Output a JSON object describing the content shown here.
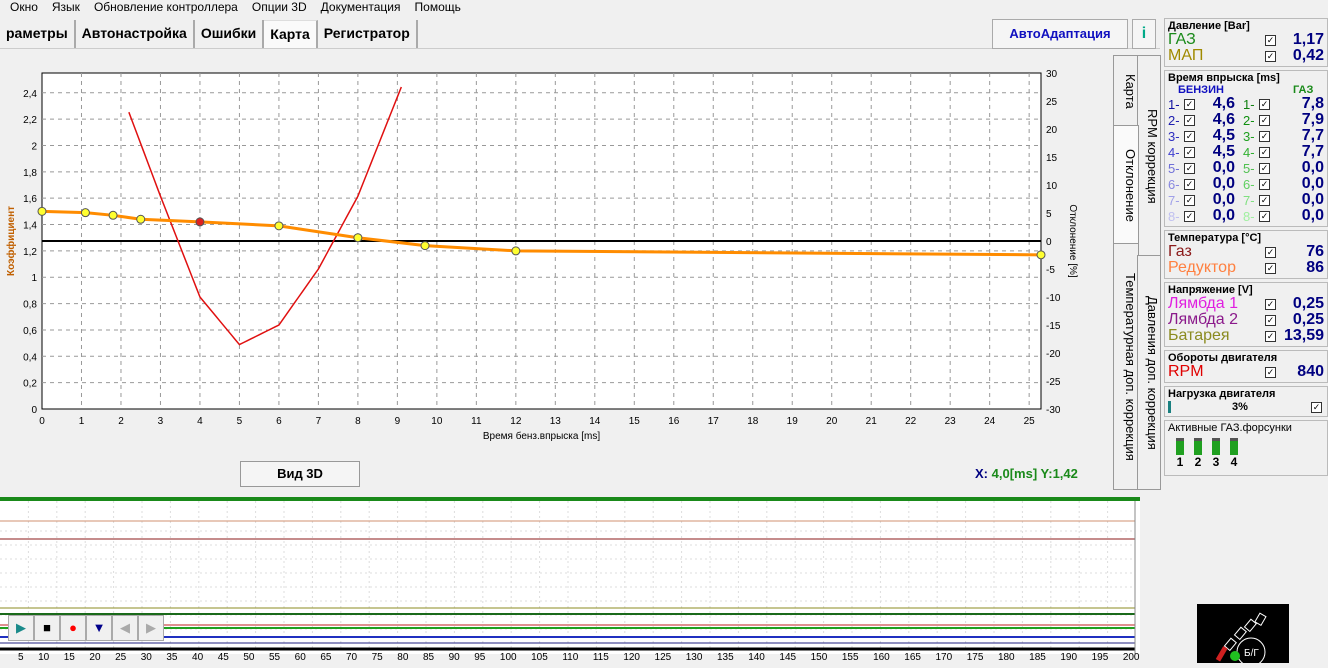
{
  "menu": [
    "Окно",
    "Язык",
    "Обновление контроллера",
    "Опции 3D",
    "Документация",
    "Помощь"
  ],
  "tabs": [
    "раметры",
    "Автонастройка",
    "Ошибки",
    "Карта",
    "Регистратор"
  ],
  "active_tab": 3,
  "auto_button": "АвтоАдаптация",
  "side_tabs": [
    "Карта",
    "RPM коррекция",
    "Отклонение",
    "Температурная доп. коррекция",
    "Давления доп. коррекция"
  ],
  "view3d": "Вид 3D",
  "coords": {
    "x_label": "X:",
    "x": "4,0[ms]",
    "y": "Y:1,42"
  },
  "chart_data": {
    "type": "line",
    "xlabel": "Время бенз.впрыска [ms]",
    "ylabel": "Коэффициент",
    "y2label": "Отклонение [%]",
    "xlim": [
      0,
      25.3
    ],
    "ylim": [
      0,
      2.55
    ],
    "y2lim": [
      -30,
      30
    ],
    "xticks": [
      0,
      1,
      2,
      3,
      4,
      5,
      6,
      7,
      8,
      9,
      10,
      11,
      12,
      13,
      14,
      15,
      16,
      17,
      18,
      19,
      20,
      21,
      22,
      23,
      24,
      25
    ],
    "yticks": [
      "0",
      "0,2",
      "0,4",
      "0,6",
      "0,8",
      "1",
      "1,2",
      "1,4",
      "1,6",
      "1,8",
      "2",
      "2,2",
      "2,4"
    ],
    "y2ticks": [
      30,
      25,
      20,
      15,
      10,
      5,
      0,
      -5,
      -10,
      -15,
      -20,
      -25,
      -30
    ],
    "coefficient": {
      "x": [
        0,
        1.1,
        1.8,
        2.5,
        4,
        6,
        8,
        9.7,
        12,
        25.3
      ],
      "y": [
        1.5,
        1.49,
        1.47,
        1.44,
        1.42,
        1.39,
        1.3,
        1.24,
        1.2,
        1.17
      ],
      "selected": 4
    },
    "deviation": {
      "x": [
        2.2,
        3,
        4,
        5,
        6,
        7,
        8,
        9.1
      ],
      "y": [
        23,
        8,
        -10,
        -18.5,
        -15,
        -5,
        8,
        27.5
      ]
    }
  },
  "panel": {
    "pressure": {
      "title": "Давление [Bar]",
      "rows": [
        {
          "label": "ГАЗ",
          "value": "1,17",
          "color": "#1a8a1a"
        },
        {
          "label": "МАП",
          "value": "0,42",
          "color": "#a08a00"
        }
      ]
    },
    "inj": {
      "title": "Время впрыска [ms]",
      "petrol": "БЕНЗИН",
      "gas": "ГАЗ",
      "petrol_vals": [
        "4,6",
        "4,6",
        "4,5",
        "4,5",
        "0,0",
        "0,0",
        "0,0",
        "0,0"
      ],
      "gas_vals": [
        "7,8",
        "7,9",
        "7,7",
        "7,7",
        "0,0",
        "0,0",
        "0,0",
        "0,0"
      ],
      "labels": [
        "1-",
        "2-",
        "3-",
        "4-",
        "5-",
        "6-",
        "7-",
        "8-"
      ]
    },
    "temp": {
      "title": "Температура  [°C]",
      "rows": [
        {
          "label": "Газ",
          "value": "76",
          "color": "#8b1a1a"
        },
        {
          "label": "Редуктор",
          "value": "86",
          "color": "#ff8040"
        }
      ]
    },
    "volt": {
      "title": "Напряжение [V]",
      "rows": [
        {
          "label": "Лямбда 1",
          "value": "0,25",
          "color": "#e020e0"
        },
        {
          "label": "Лямбда 2",
          "value": "0,25",
          "color": "#8b1a8b"
        },
        {
          "label": "Батарея",
          "value": "13,59",
          "color": "#8b8b20"
        }
      ]
    },
    "rpm": {
      "title": "Обороты двигателя",
      "label": "RPM",
      "value": "840"
    },
    "load": {
      "title": "Нагрузка двигателя",
      "value": "3%",
      "fraction": 0.03
    },
    "injectors": {
      "title": "Активные ГАЗ.форсунки",
      "items": [
        "1",
        "2",
        "3",
        "4"
      ]
    }
  },
  "logger_axis": [
    "5",
    "10",
    "15",
    "20",
    "25",
    "30",
    "35",
    "40",
    "45",
    "50",
    "55",
    "60",
    "65",
    "70",
    "75",
    "80",
    "85",
    "90",
    "95",
    "100",
    "105",
    "110",
    "115",
    "120",
    "125",
    "130",
    "135",
    "140",
    "145",
    "150",
    "155",
    "160",
    "165",
    "170",
    "175",
    "180",
    "185",
    "190",
    "195",
    "200"
  ],
  "gauge_label": "Б/Г"
}
